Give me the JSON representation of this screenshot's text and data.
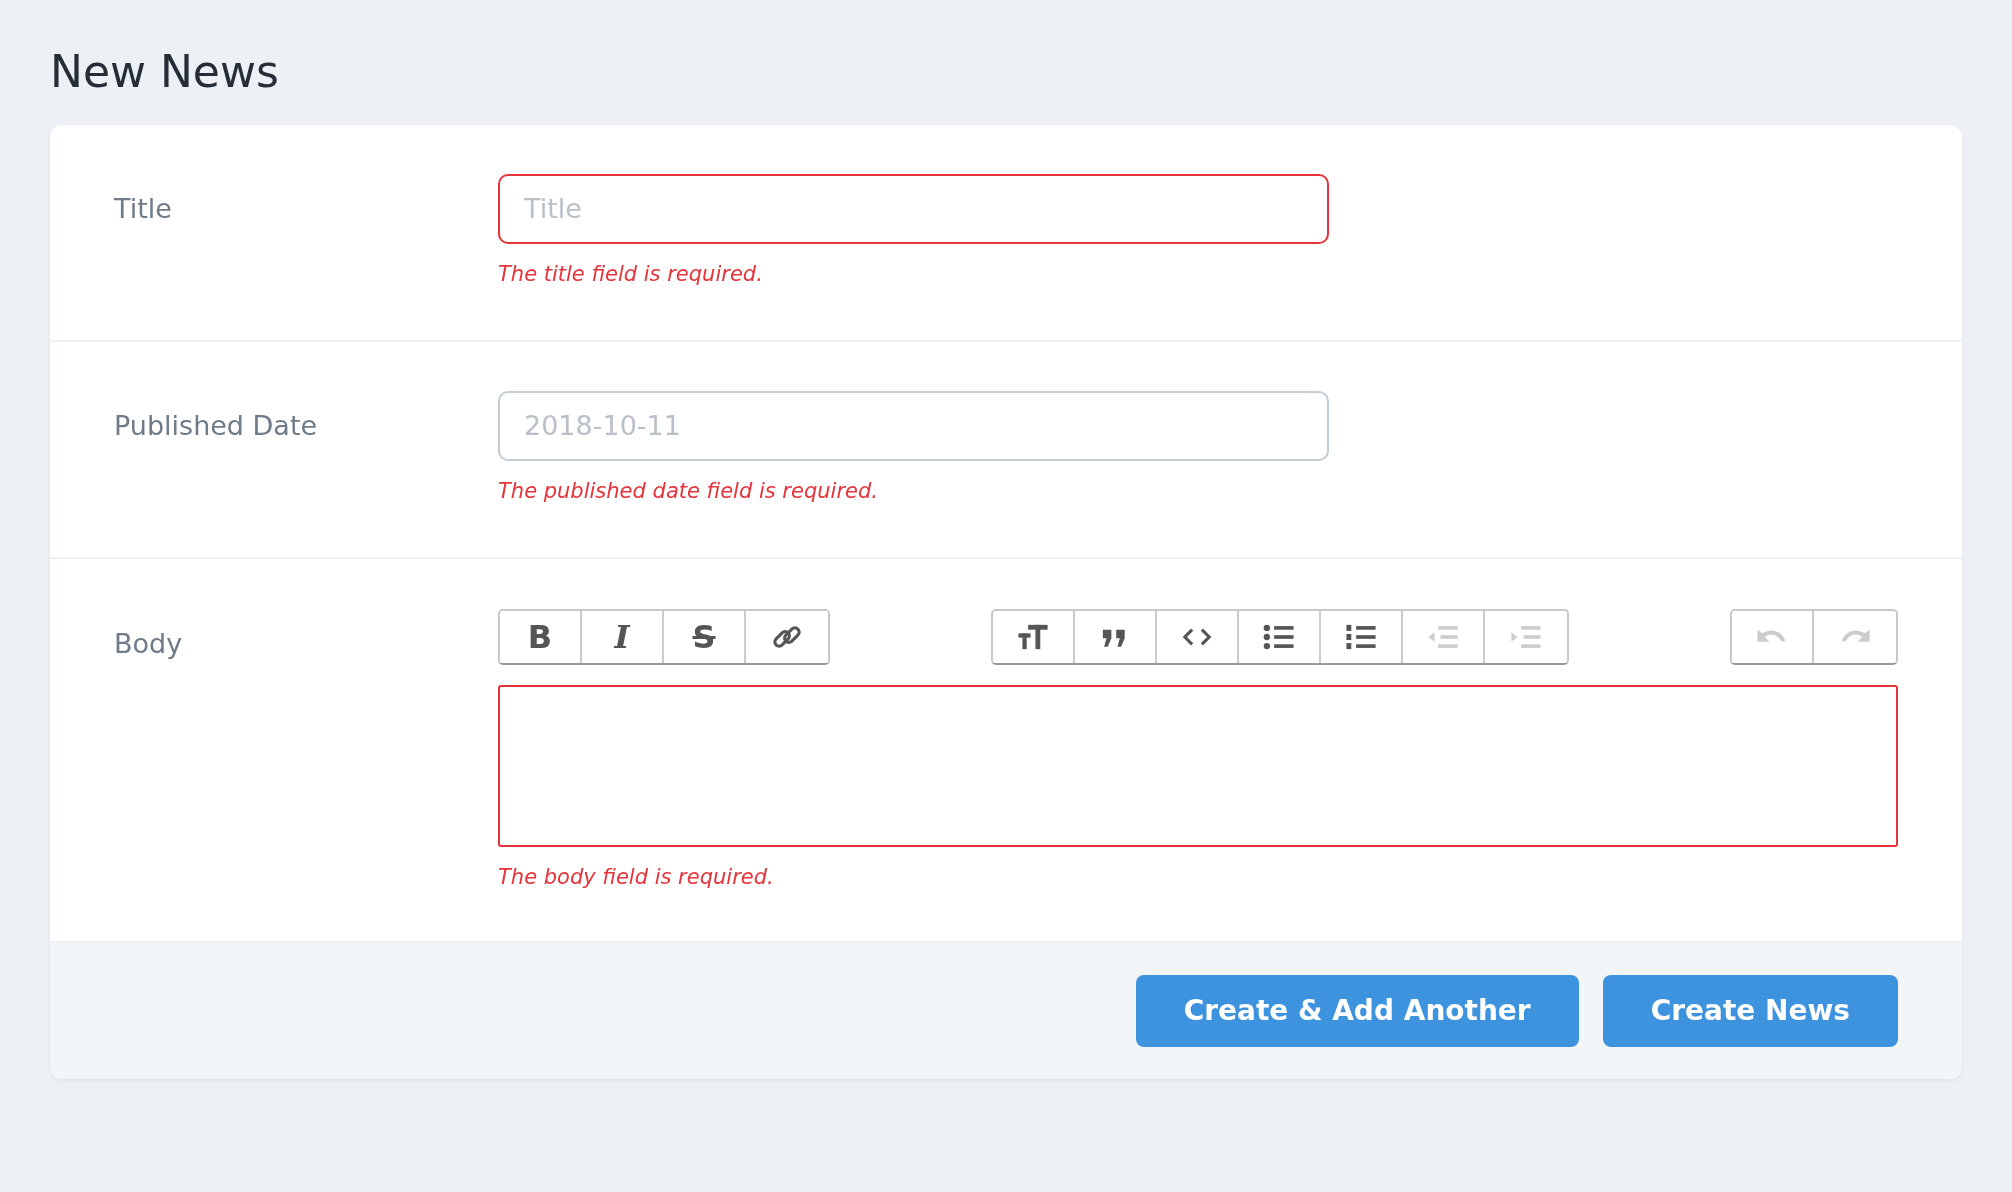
{
  "page": {
    "title": "New News"
  },
  "fields": [
    {
      "kind": "text",
      "label": "Title",
      "placeholder": "Title",
      "invalid": true,
      "error": "The title field is required."
    },
    {
      "kind": "text",
      "label": "Published Date",
      "placeholder": "2018-10-11",
      "invalid": false,
      "error": "The published date field is required."
    },
    {
      "kind": "editor",
      "label": "Body",
      "invalid": true,
      "error": "The body field is required.",
      "toolbar": [
        [
          {
            "kind": "bold",
            "glyph": "B",
            "disabled": false
          },
          {
            "kind": "italic",
            "glyph": "I",
            "disabled": false
          },
          {
            "kind": "strike",
            "glyph": "S",
            "disabled": false
          },
          {
            "kind": "link",
            "disabled": false
          }
        ],
        [
          {
            "kind": "heading",
            "disabled": false
          },
          {
            "kind": "quote",
            "disabled": false
          },
          {
            "kind": "code",
            "disabled": false
          },
          {
            "kind": "bullets",
            "disabled": false
          },
          {
            "kind": "numbers",
            "disabled": false
          },
          {
            "kind": "outdent",
            "disabled": true
          },
          {
            "kind": "indent",
            "disabled": true
          }
        ],
        [
          {
            "kind": "undo",
            "disabled": true
          },
          {
            "kind": "redo",
            "disabled": true
          }
        ]
      ]
    }
  ],
  "buttons": [
    "Create & Add Another",
    "Create News"
  ]
}
